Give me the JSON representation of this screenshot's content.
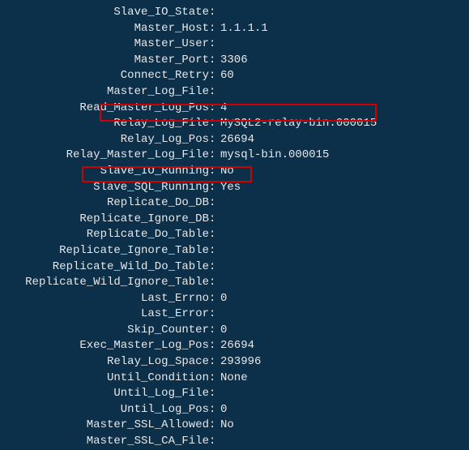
{
  "status": {
    "fields": [
      {
        "label": "Slave_IO_State",
        "value": ""
      },
      {
        "label": "Master_Host",
        "value": "1.1.1.1"
      },
      {
        "label": "Master_User",
        "value": ""
      },
      {
        "label": "Master_Port",
        "value": "3306"
      },
      {
        "label": "Connect_Retry",
        "value": "60"
      },
      {
        "label": "Master_Log_File",
        "value": ""
      },
      {
        "label": "Read_Master_Log_Pos",
        "value": "4"
      },
      {
        "label": "Relay_Log_File",
        "value": "MySQL2-relay-bin.000015"
      },
      {
        "label": "Relay_Log_Pos",
        "value": "26694"
      },
      {
        "label": "Relay_Master_Log_File",
        "value": "mysql-bin.000015"
      },
      {
        "label": "Slave_IO_Running",
        "value": "No"
      },
      {
        "label": "Slave_SQL_Running",
        "value": "Yes"
      },
      {
        "label": "Replicate_Do_DB",
        "value": ""
      },
      {
        "label": "Replicate_Ignore_DB",
        "value": ""
      },
      {
        "label": "Replicate_Do_Table",
        "value": ""
      },
      {
        "label": "Replicate_Ignore_Table",
        "value": ""
      },
      {
        "label": "Replicate_Wild_Do_Table",
        "value": ""
      },
      {
        "label": "Replicate_Wild_Ignore_Table",
        "value": ""
      },
      {
        "label": "Last_Errno",
        "value": "0"
      },
      {
        "label": "Last_Error",
        "value": ""
      },
      {
        "label": "Skip_Counter",
        "value": "0"
      },
      {
        "label": "Exec_Master_Log_Pos",
        "value": "26694"
      },
      {
        "label": "Relay_Log_Space",
        "value": "293996"
      },
      {
        "label": "Until_Condition",
        "value": "None"
      },
      {
        "label": "Until_Log_File",
        "value": ""
      },
      {
        "label": "Until_Log_Pos",
        "value": "0"
      },
      {
        "label": "Master_SSL_Allowed",
        "value": "No"
      },
      {
        "label": "Master_SSL_CA_File",
        "value": ""
      }
    ]
  }
}
